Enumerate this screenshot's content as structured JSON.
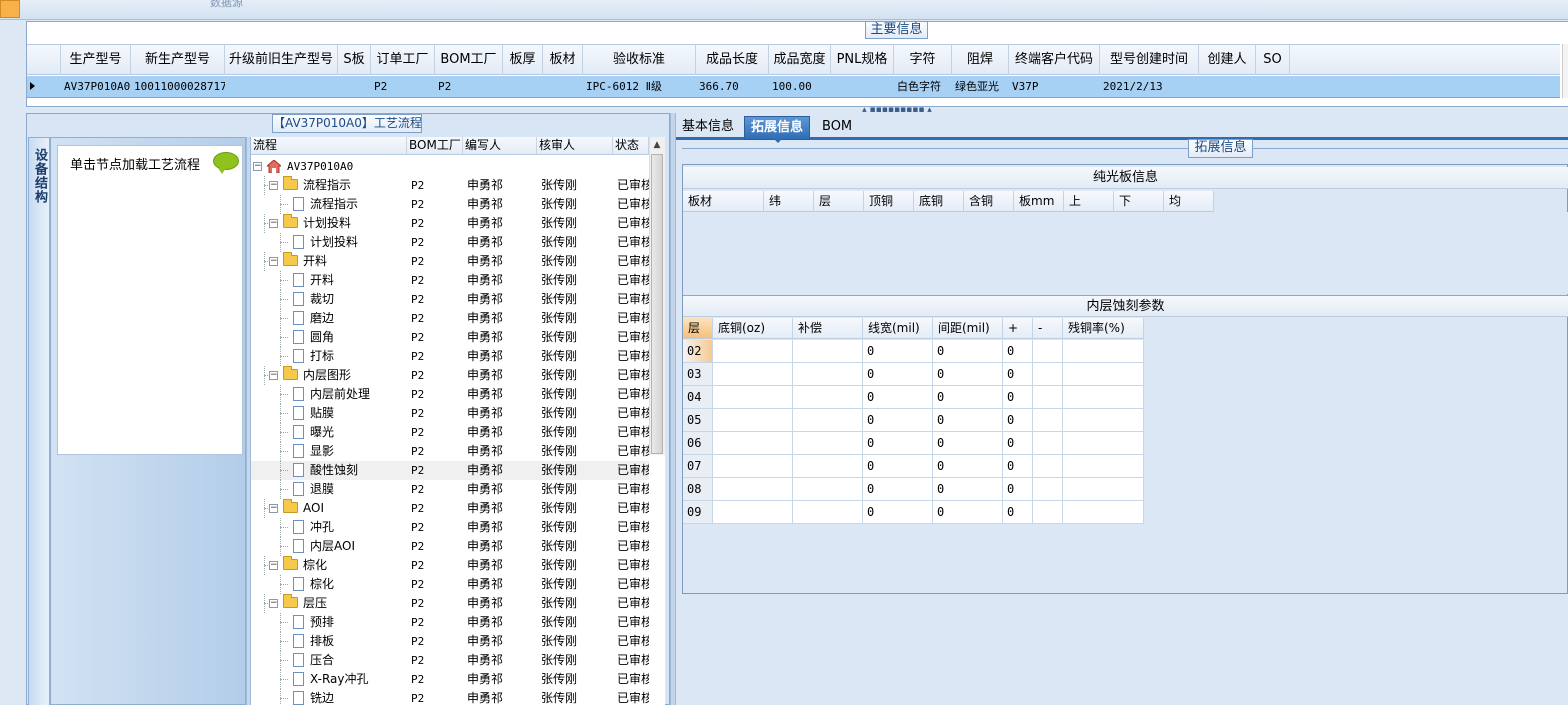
{
  "top": {
    "faint_text": "数据源"
  },
  "main_info": {
    "title": "主要信息",
    "columns": [
      "生产型号",
      "新生产型号",
      "升级前旧生产型号",
      "S板",
      "订单工厂",
      "BOM工厂",
      "板厚",
      "板材",
      "验收标准",
      "成品长度",
      "成品宽度",
      "PNL规格",
      "字符",
      "阻焊",
      "终端客户代码",
      "型号创建时间",
      "创建人",
      "SO"
    ],
    "row": [
      "AV37P010A0",
      "10011000028717",
      "",
      "",
      "P2",
      "P2",
      "",
      "",
      "IPC-6012 Ⅱ级",
      "366.70",
      "100.00",
      "",
      "白色字符",
      "绿色亚光",
      "V37P",
      "2021/2/13",
      "",
      ""
    ]
  },
  "left": {
    "vertical_tab": "设备结构",
    "load_text": "单击节点加载工艺流程",
    "flow_title": "【AV37P010A0】工艺流程",
    "tree_columns": [
      "流程",
      "BOM工厂",
      "编写人",
      "核审人",
      "状态"
    ],
    "tree_rows": [
      {
        "level": 0,
        "type": "root",
        "name": "AV37P010A0",
        "bom": "",
        "author": "",
        "reviewer": "",
        "status": ""
      },
      {
        "level": 1,
        "type": "folder",
        "name": "流程指示",
        "bom": "P2",
        "author": "申勇祁",
        "reviewer": "张传刚",
        "status": "已审核"
      },
      {
        "level": 2,
        "type": "doc",
        "name": "流程指示",
        "bom": "P2",
        "author": "申勇祁",
        "reviewer": "张传刚",
        "status": "已审核"
      },
      {
        "level": 1,
        "type": "folder",
        "name": "计划投料",
        "bom": "P2",
        "author": "申勇祁",
        "reviewer": "张传刚",
        "status": "已审核"
      },
      {
        "level": 2,
        "type": "doc",
        "name": "计划投料",
        "bom": "P2",
        "author": "申勇祁",
        "reviewer": "张传刚",
        "status": "已审核"
      },
      {
        "level": 1,
        "type": "folder",
        "name": "开料",
        "bom": "P2",
        "author": "申勇祁",
        "reviewer": "张传刚",
        "status": "已审核"
      },
      {
        "level": 2,
        "type": "doc",
        "name": "开料",
        "bom": "P2",
        "author": "申勇祁",
        "reviewer": "张传刚",
        "status": "已审核"
      },
      {
        "level": 2,
        "type": "doc",
        "name": "裁切",
        "bom": "P2",
        "author": "申勇祁",
        "reviewer": "张传刚",
        "status": "已审核"
      },
      {
        "level": 2,
        "type": "doc",
        "name": "磨边",
        "bom": "P2",
        "author": "申勇祁",
        "reviewer": "张传刚",
        "status": "已审核"
      },
      {
        "level": 2,
        "type": "doc",
        "name": "圆角",
        "bom": "P2",
        "author": "申勇祁",
        "reviewer": "张传刚",
        "status": "已审核"
      },
      {
        "level": 2,
        "type": "doc",
        "name": "打标",
        "bom": "P2",
        "author": "申勇祁",
        "reviewer": "张传刚",
        "status": "已审核"
      },
      {
        "level": 1,
        "type": "folder",
        "name": "内层图形",
        "bom": "P2",
        "author": "申勇祁",
        "reviewer": "张传刚",
        "status": "已审核"
      },
      {
        "level": 2,
        "type": "doc",
        "name": "内层前处理",
        "bom": "P2",
        "author": "申勇祁",
        "reviewer": "张传刚",
        "status": "已审核"
      },
      {
        "level": 2,
        "type": "doc",
        "name": "贴膜",
        "bom": "P2",
        "author": "申勇祁",
        "reviewer": "张传刚",
        "status": "已审核"
      },
      {
        "level": 2,
        "type": "doc",
        "name": "曝光",
        "bom": "P2",
        "author": "申勇祁",
        "reviewer": "张传刚",
        "status": "已审核"
      },
      {
        "level": 2,
        "type": "doc",
        "name": "显影",
        "bom": "P2",
        "author": "申勇祁",
        "reviewer": "张传刚",
        "status": "已审核"
      },
      {
        "level": 2,
        "type": "doc",
        "name": "酸性蚀刻",
        "bom": "P2",
        "author": "申勇祁",
        "reviewer": "张传刚",
        "status": "已审核",
        "selected": true
      },
      {
        "level": 2,
        "type": "doc",
        "name": "退膜",
        "bom": "P2",
        "author": "申勇祁",
        "reviewer": "张传刚",
        "status": "已审核"
      },
      {
        "level": 1,
        "type": "folder",
        "name": "AOI",
        "bom": "P2",
        "author": "申勇祁",
        "reviewer": "张传刚",
        "status": "已审核"
      },
      {
        "level": 2,
        "type": "doc",
        "name": "冲孔",
        "bom": "P2",
        "author": "申勇祁",
        "reviewer": "张传刚",
        "status": "已审核"
      },
      {
        "level": 2,
        "type": "doc",
        "name": "内层AOI",
        "bom": "P2",
        "author": "申勇祁",
        "reviewer": "张传刚",
        "status": "已审核"
      },
      {
        "level": 1,
        "type": "folder",
        "name": "棕化",
        "bom": "P2",
        "author": "申勇祁",
        "reviewer": "张传刚",
        "status": "已审核"
      },
      {
        "level": 2,
        "type": "doc",
        "name": "棕化",
        "bom": "P2",
        "author": "申勇祁",
        "reviewer": "张传刚",
        "status": "已审核"
      },
      {
        "level": 1,
        "type": "folder",
        "name": "层压",
        "bom": "P2",
        "author": "申勇祁",
        "reviewer": "张传刚",
        "status": "已审核"
      },
      {
        "level": 2,
        "type": "doc",
        "name": "预排",
        "bom": "P2",
        "author": "申勇祁",
        "reviewer": "张传刚",
        "status": "已审核"
      },
      {
        "level": 2,
        "type": "doc",
        "name": "排板",
        "bom": "P2",
        "author": "申勇祁",
        "reviewer": "张传刚",
        "status": "已审核"
      },
      {
        "level": 2,
        "type": "doc",
        "name": "压合",
        "bom": "P2",
        "author": "申勇祁",
        "reviewer": "张传刚",
        "status": "已审核"
      },
      {
        "level": 2,
        "type": "doc",
        "name": "X-Ray冲孔",
        "bom": "P2",
        "author": "申勇祁",
        "reviewer": "张传刚",
        "status": "已审核"
      },
      {
        "level": 2,
        "type": "doc",
        "name": "铣边",
        "bom": "P2",
        "author": "申勇祁",
        "reviewer": "张传刚",
        "status": "已审核"
      }
    ]
  },
  "right": {
    "tabs": [
      {
        "label": "基本信息",
        "active": false
      },
      {
        "label": "拓展信息",
        "active": true
      },
      {
        "label": "BOM",
        "active": false
      }
    ],
    "section_title": "拓展信息",
    "pure_board": {
      "title": "纯光板信息",
      "columns": [
        "板材",
        "纬",
        "层",
        "顶铜",
        "底铜",
        "含铜",
        "板mm",
        "上",
        "下",
        "均"
      ]
    },
    "etch": {
      "title": "内层蚀刻参数",
      "columns": [
        "层",
        "底铜(oz)",
        "补偿",
        "线宽(mil)",
        "间距(mil)",
        "+",
        "-",
        "残铜率(%)"
      ],
      "rows": [
        [
          "02",
          "",
          "",
          "0",
          "0",
          "0",
          "",
          ""
        ],
        [
          "03",
          "",
          "",
          "0",
          "0",
          "0",
          "",
          ""
        ],
        [
          "04",
          "",
          "",
          "0",
          "0",
          "0",
          "",
          ""
        ],
        [
          "05",
          "",
          "",
          "0",
          "0",
          "0",
          "",
          ""
        ],
        [
          "06",
          "",
          "",
          "0",
          "0",
          "0",
          "",
          ""
        ],
        [
          "07",
          "",
          "",
          "0",
          "0",
          "0",
          "",
          ""
        ],
        [
          "08",
          "",
          "",
          "0",
          "0",
          "0",
          "",
          ""
        ],
        [
          "09",
          "",
          "",
          "0",
          "0",
          "0",
          "",
          ""
        ]
      ]
    }
  }
}
